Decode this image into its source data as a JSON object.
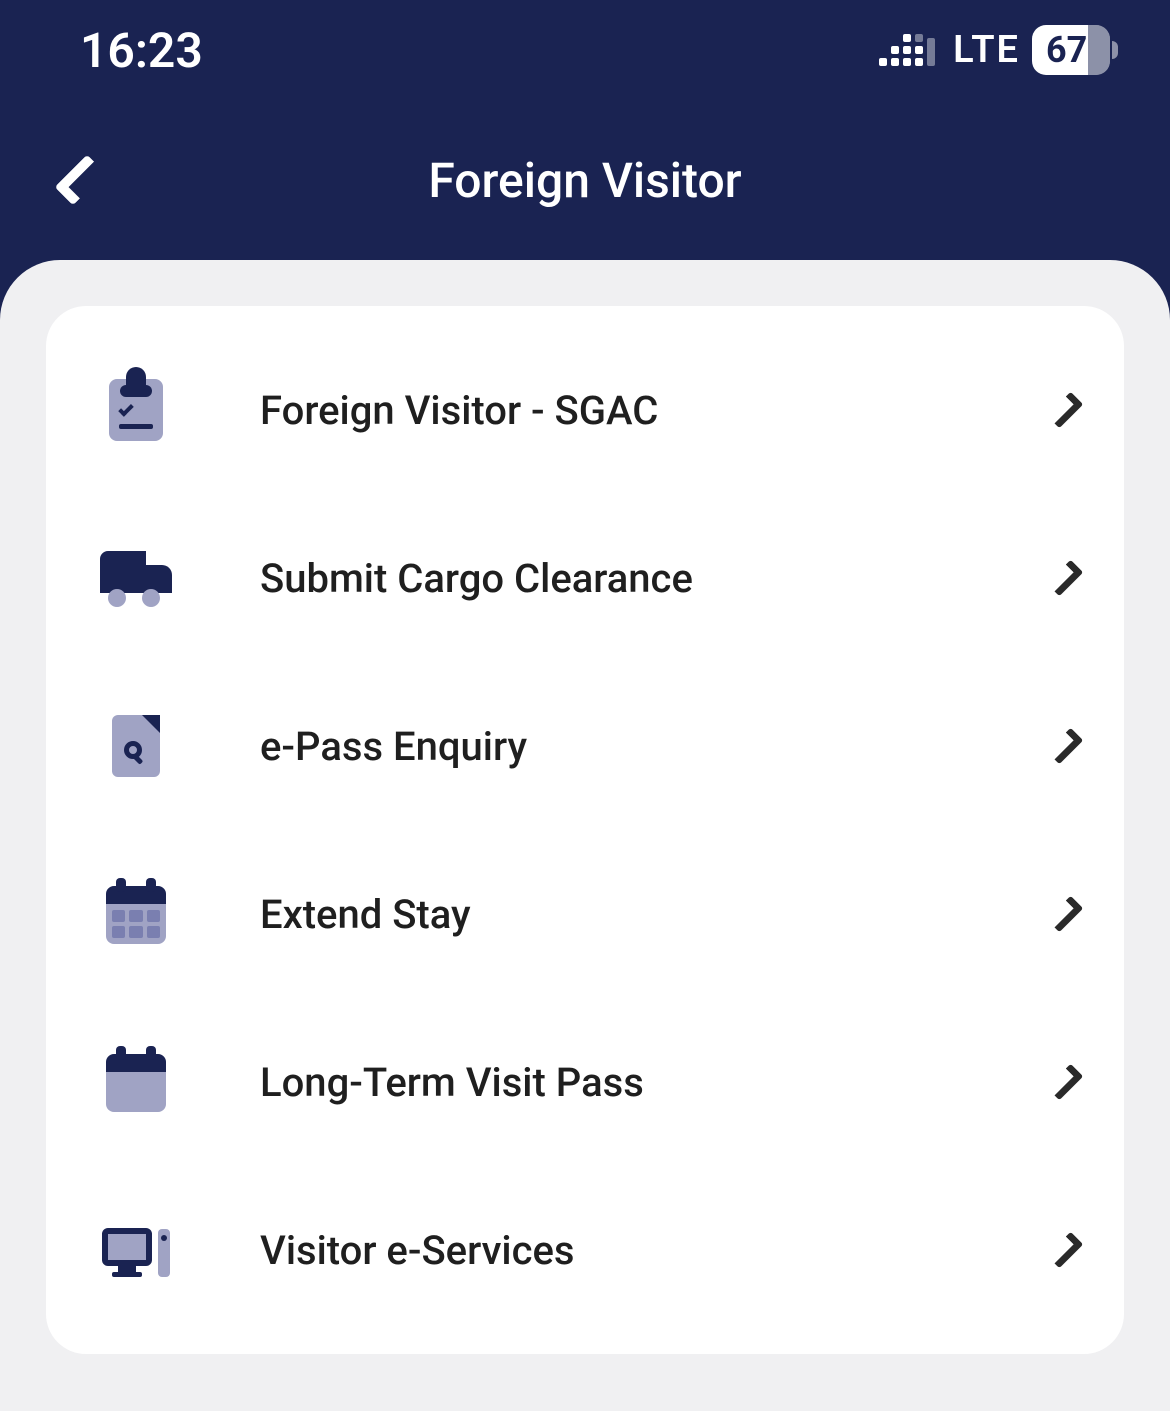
{
  "status_bar": {
    "time": "16:23",
    "network_type": "LTE",
    "battery_percent": "67"
  },
  "header": {
    "title": "Foreign Visitor"
  },
  "menu": {
    "items": [
      {
        "label": "Foreign Visitor - SGAC",
        "icon": "clipboard-icon"
      },
      {
        "label": "Submit Cargo Clearance",
        "icon": "truck-icon"
      },
      {
        "label": "e-Pass Enquiry",
        "icon": "document-search-icon"
      },
      {
        "label": "Extend Stay",
        "icon": "calendar-grid-icon"
      },
      {
        "label": "Long-Term Visit Pass",
        "icon": "calendar-icon"
      },
      {
        "label": "Visitor e-Services",
        "icon": "computer-icon"
      }
    ]
  }
}
